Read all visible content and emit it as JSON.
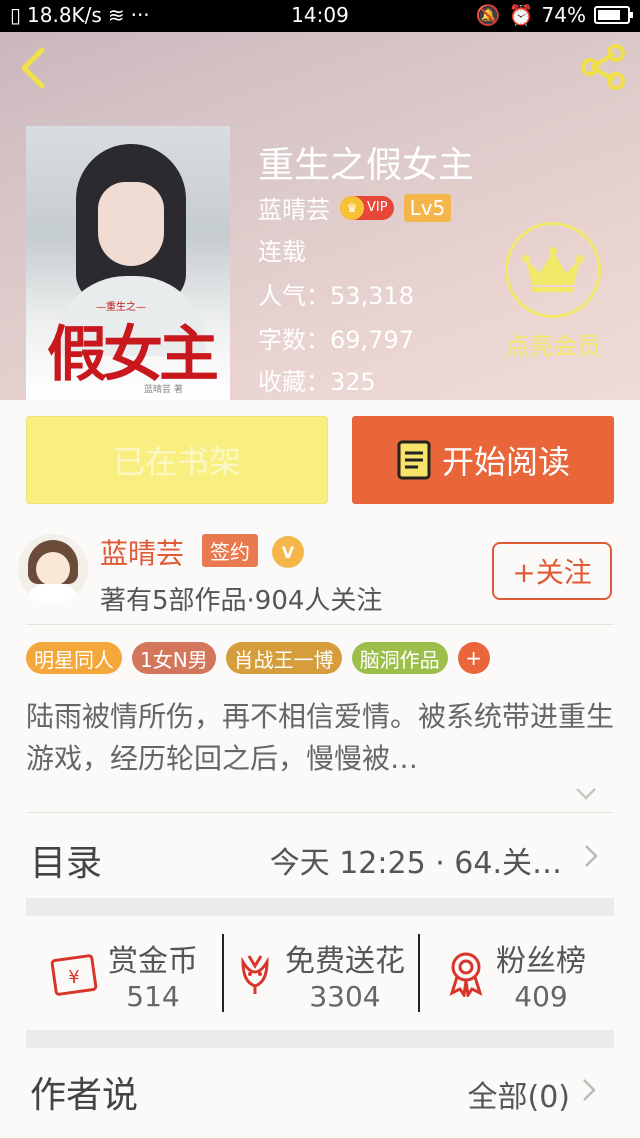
{
  "status_bar": {
    "speed": "18.8K/s",
    "dots": "···",
    "time": "14:09",
    "battery": "74%"
  },
  "book": {
    "title": "重生之假女主",
    "author": "蓝晴芸",
    "vip": "VIP",
    "level": "Lv5",
    "status": "连载",
    "popularity": "人气：53,318",
    "word_count": "字数：69,797",
    "favorites": "收藏：325",
    "cover": {
      "title_art": "假女主",
      "subtitle_art": "—重生之—",
      "author_art": "蓝晴芸 著"
    }
  },
  "member": {
    "label": "点亮会员"
  },
  "actions": {
    "shelf": "已在书架",
    "read": "开始阅读"
  },
  "author_card": {
    "name": "蓝晴芸",
    "sign": "签约",
    "v": "V",
    "meta": "著有5部作品·904人关注",
    "follow": "+关注"
  },
  "tags": [
    {
      "label": "明星同人",
      "color": "#f4a73b"
    },
    {
      "label": "1女N男",
      "color": "#d2775c"
    },
    {
      "label": "肖战王一博",
      "color": "#d59d3b"
    },
    {
      "label": "脑洞作品",
      "color": "#9bbf4a"
    }
  ],
  "tag_more": "+",
  "synopsis": "陆雨被情所伤，再不相信爱情。被系统带进重生游戏，经历轮回之后，慢慢被…",
  "catalog": {
    "title": "目录",
    "latest": "今天 12:25 · 64.关…"
  },
  "stats": [
    {
      "label": "赏金币",
      "value": "514",
      "icon": "red-envelope-icon"
    },
    {
      "label": "免费送花",
      "value": "3304",
      "icon": "flower-icon"
    },
    {
      "label": "粉丝榜",
      "value": "409",
      "icon": "rank-medal-icon"
    }
  ],
  "author_says": {
    "title": "作者说",
    "all": "全部(0)"
  },
  "colors": {
    "accent": "#e9663b",
    "shelf_button": "#f8ef80",
    "member_yellow": "#f2e86a",
    "author_red": "#e05a36"
  }
}
